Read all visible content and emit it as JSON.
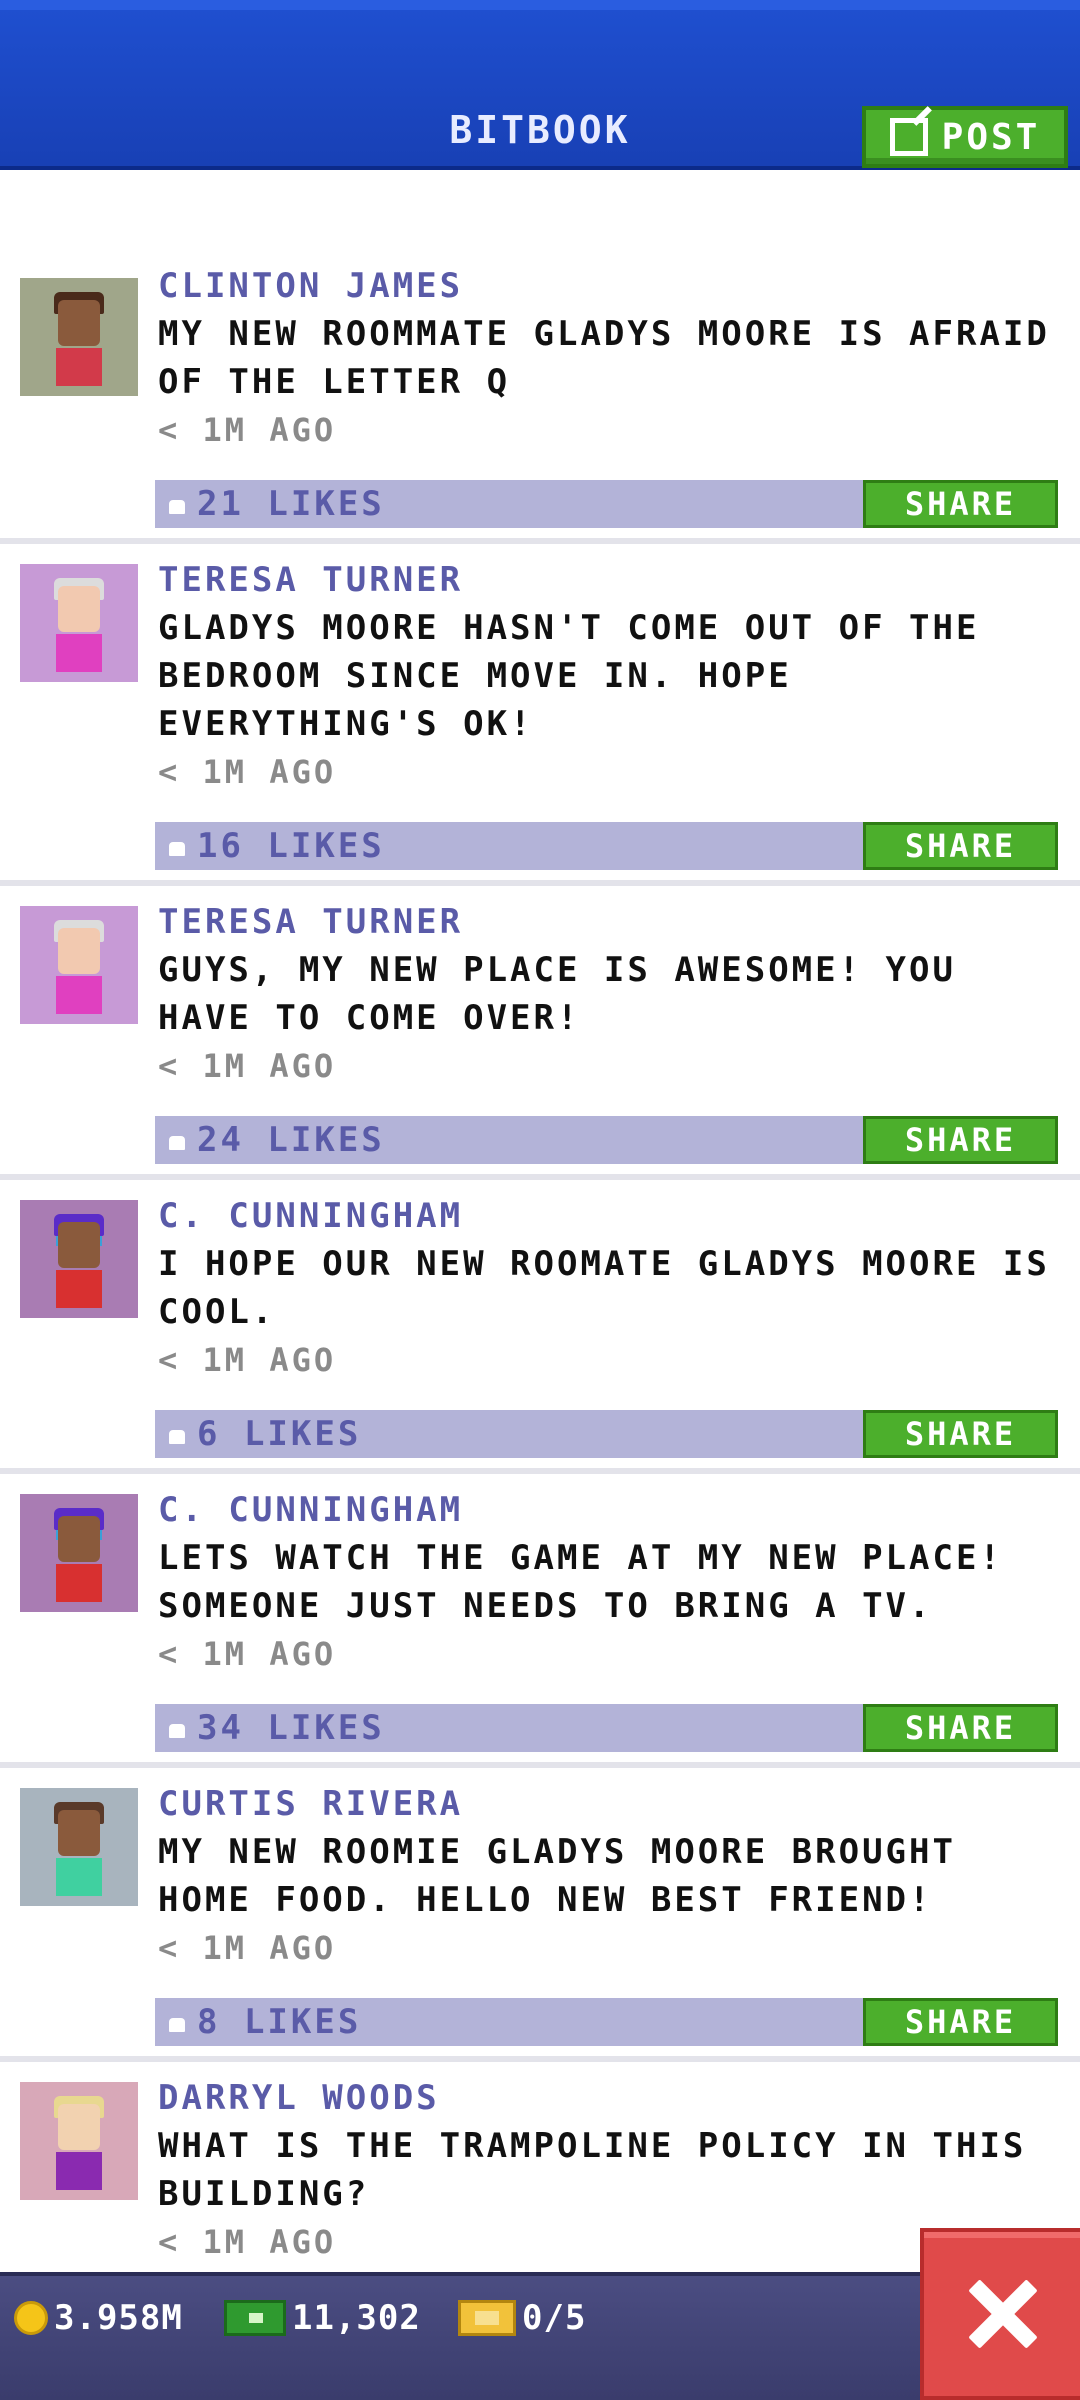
{
  "header": {
    "title": "BITBOOK",
    "post_label": "POST"
  },
  "posts": [
    {
      "author": "CLINTON JAMES",
      "message": "MY NEW ROOMMATE GLADYS MOORE IS AFRAID OF THE LETTER Q",
      "time": "< 1M AGO",
      "likes": "21 LIKES",
      "share_label": "SHARE",
      "avatar": {
        "bg": "#a0a68a",
        "skin": "#8a5a3c",
        "hair": "#4a2a1a",
        "shirt": "#d23a4a",
        "shades": false
      }
    },
    {
      "author": "TERESA TURNER",
      "message": "GLADYS MOORE HASN'T COME OUT OF THE BEDROOM SINCE MOVE IN. HOPE EVERYTHING'S OK!",
      "time": "< 1M AGO",
      "likes": "16 LIKES",
      "share_label": "SHARE",
      "avatar": {
        "bg": "#c79ad6",
        "skin": "#f2c9b0",
        "hair": "#dcdcdc",
        "shirt": "#e040c0",
        "shades": false
      }
    },
    {
      "author": "TERESA TURNER",
      "message": "GUYS, MY NEW PLACE IS AWESOME! YOU HAVE TO COME OVER!",
      "time": "< 1M AGO",
      "likes": "24 LIKES",
      "share_label": "SHARE",
      "avatar": {
        "bg": "#c79ad6",
        "skin": "#f2c9b0",
        "hair": "#dcdcdc",
        "shirt": "#e040c0",
        "shades": false
      }
    },
    {
      "author": "C. CUNNINGHAM",
      "message": "I HOPE OUR NEW ROOMATE GLADYS MOORE IS COOL.",
      "time": "< 1M AGO",
      "likes": "6 LIKES",
      "share_label": "SHARE",
      "avatar": {
        "bg": "#a97cb3",
        "skin": "#8a5a3c",
        "hair": "#5a2cc8",
        "shirt": "#d83030",
        "shades": true
      }
    },
    {
      "author": "C. CUNNINGHAM",
      "message": "LETS WATCH THE GAME AT MY NEW PLACE! SOMEONE JUST NEEDS TO BRING A TV.",
      "time": "< 1M AGO",
      "likes": "34 LIKES",
      "share_label": "SHARE",
      "avatar": {
        "bg": "#a97cb3",
        "skin": "#8a5a3c",
        "hair": "#5a2cc8",
        "shirt": "#d83030",
        "shades": true
      }
    },
    {
      "author": "CURTIS RIVERA",
      "message": "MY NEW ROOMIE GLADYS MOORE BROUGHT HOME FOOD. HELLO NEW BEST FRIEND!",
      "time": "< 1M AGO",
      "likes": "8 LIKES",
      "share_label": "SHARE",
      "avatar": {
        "bg": "#a8b4be",
        "skin": "#8a5a3c",
        "hair": "#5a3a2a",
        "shirt": "#40d0a0",
        "shades": false
      }
    },
    {
      "author": "DARRYL WOODS",
      "message": "WHAT IS THE TRAMPOLINE POLICY IN THIS BUILDING?",
      "time": "< 1M AGO",
      "likes": "",
      "share_label": "",
      "avatar": {
        "bg": "#d8a8b8",
        "skin": "#f2d2b0",
        "hair": "#e8d890",
        "shirt": "#8a2ab0",
        "shades": false
      }
    }
  ],
  "status": {
    "coins": "3.958M",
    "bux": "11,302",
    "tickets": "0/5"
  },
  "colors": {
    "header": "#1840b5",
    "accent_green": "#4caf2c",
    "likes_bar": "#b3b3d8",
    "close_red": "#e04a4a"
  }
}
